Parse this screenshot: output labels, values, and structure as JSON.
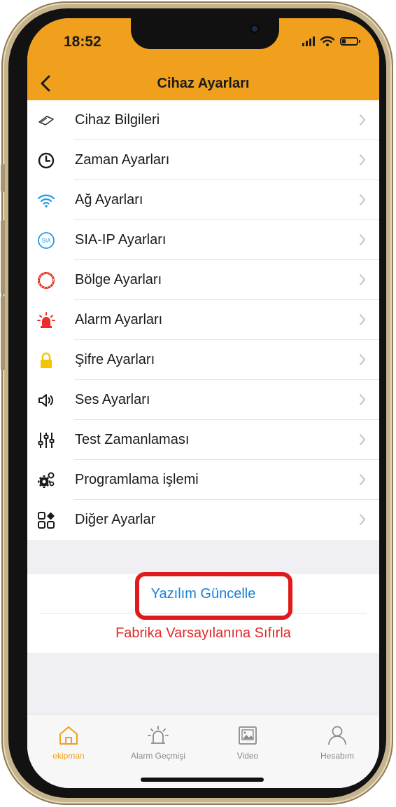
{
  "status_bar": {
    "time": "18:52"
  },
  "nav": {
    "title": "Cihaz Ayarları"
  },
  "settings": [
    {
      "label": "Cihaz Bilgileri",
      "icon": "device-icon"
    },
    {
      "label": "Zaman Ayarları",
      "icon": "clock-icon"
    },
    {
      "label": "Ağ Ayarları",
      "icon": "wifi-icon"
    },
    {
      "label": "SIA-IP Ayarları",
      "icon": "sia-icon"
    },
    {
      "label": "Bölge Ayarları",
      "icon": "zone-ring-icon"
    },
    {
      "label": "Alarm Ayarları",
      "icon": "siren-icon"
    },
    {
      "label": "Şifre Ayarları",
      "icon": "lock-icon"
    },
    {
      "label": "Ses Ayarları",
      "icon": "speaker-icon"
    },
    {
      "label": "Test Zamanlaması",
      "icon": "sliders-icon"
    },
    {
      "label": "Programlama işlemi",
      "icon": "gears-icon"
    },
    {
      "label": "Diğer Ayarlar",
      "icon": "grid-icon"
    }
  ],
  "actions": {
    "update": "Yazılım Güncelle",
    "reset": "Fabrika Varsayılanına Sıfırla"
  },
  "tabs": [
    {
      "label": "ekipman",
      "icon": "home-icon",
      "active": true
    },
    {
      "label": "Alarm Geçmişi",
      "icon": "alarm-icon",
      "active": false
    },
    {
      "label": "Video",
      "icon": "video-icon",
      "active": false
    },
    {
      "label": "Hesabım",
      "icon": "person-icon",
      "active": false
    }
  ],
  "colors": {
    "accent": "#f0a01c",
    "link": "#1a7fd4",
    "danger": "#e02a2a",
    "highlight": "#e01a1a"
  }
}
